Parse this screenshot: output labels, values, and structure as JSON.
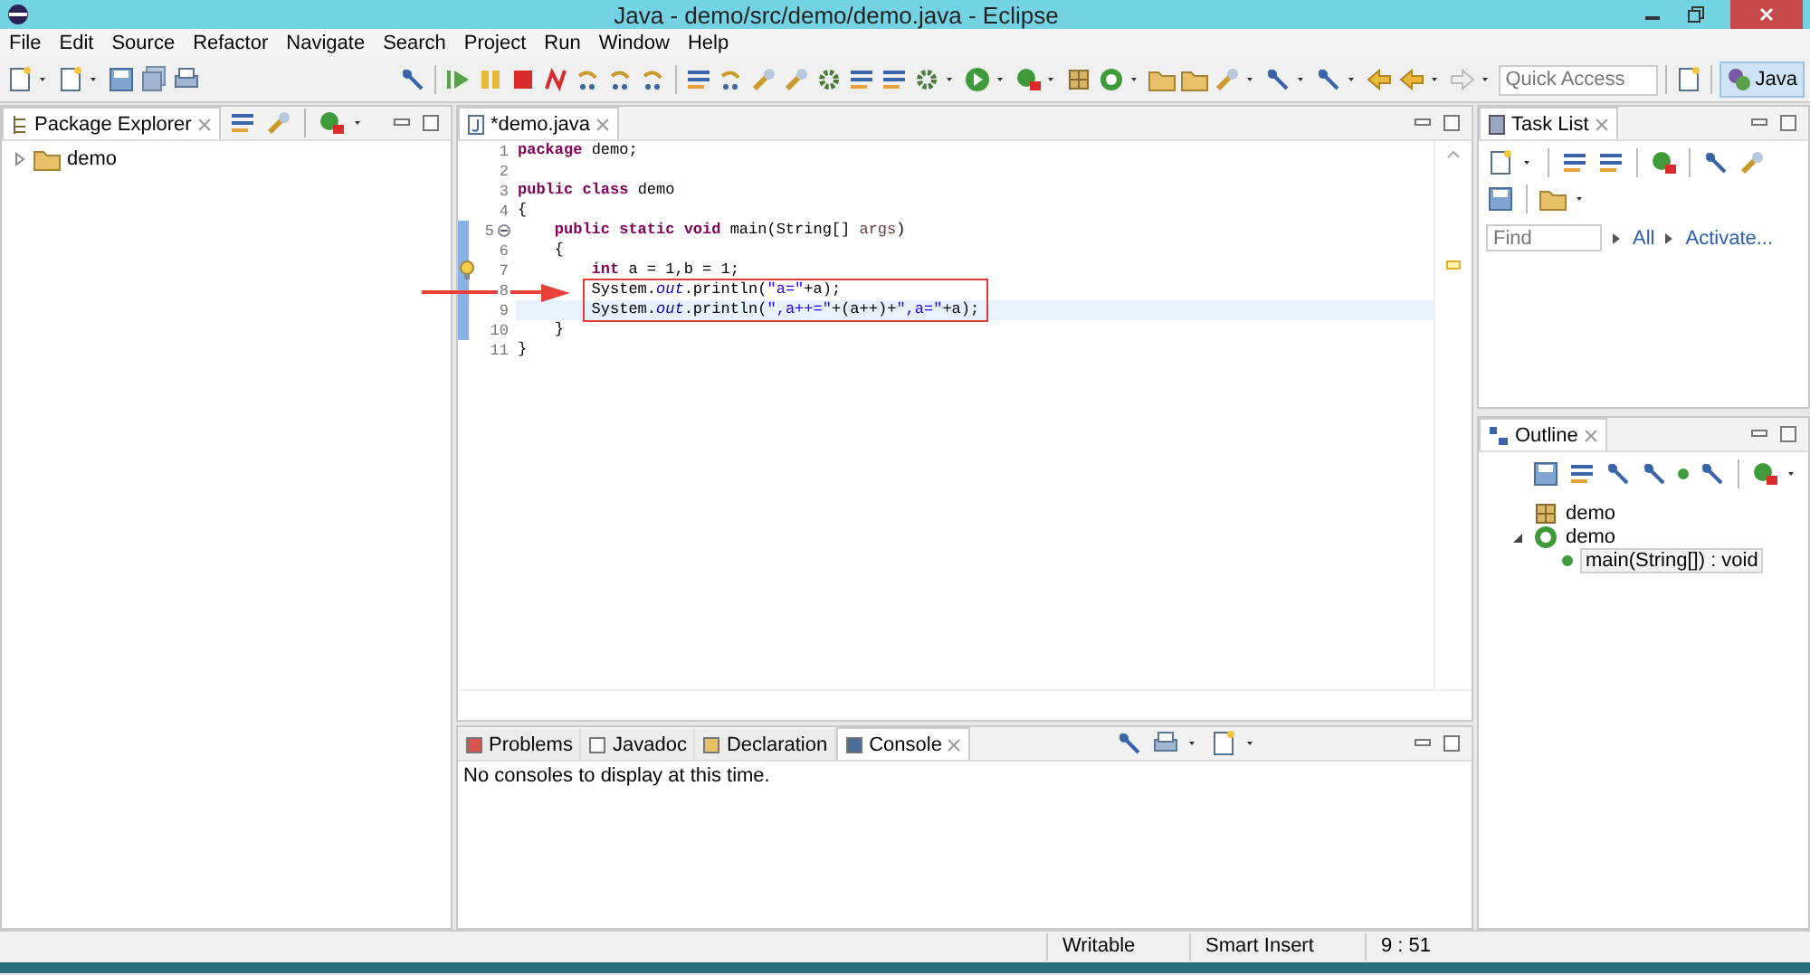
{
  "window": {
    "title": "Java - demo/src/demo/demo.java - Eclipse"
  },
  "menu": [
    "File",
    "Edit",
    "Source",
    "Refactor",
    "Navigate",
    "Search",
    "Project",
    "Run",
    "Window",
    "Help"
  ],
  "quick_access": {
    "placeholder": "Quick Access"
  },
  "perspectives": [
    {
      "label": "Java",
      "selected": true
    }
  ],
  "package_explorer": {
    "tabs": [
      {
        "label": "Package Explorer",
        "selected": true
      }
    ],
    "tree": [
      {
        "label": "demo",
        "expanded": false
      }
    ]
  },
  "editor": {
    "tabs": [
      {
        "label": "*demo.java",
        "selected": true
      }
    ],
    "lines": [
      {
        "number": "1",
        "current": false,
        "changed": false,
        "fold": false,
        "warning": false,
        "tokens": [
          {
            "kind": "keyword",
            "text": "package"
          },
          {
            "kind": "plain",
            "text": " demo;"
          }
        ]
      },
      {
        "number": "2",
        "current": false,
        "changed": false,
        "fold": false,
        "warning": false
      },
      {
        "number": "3",
        "current": false,
        "changed": false,
        "fold": false,
        "warning": false,
        "tokens": [
          {
            "kind": "keyword",
            "text": "public class"
          },
          {
            "kind": "plain",
            "text": " demo"
          }
        ]
      },
      {
        "number": "4",
        "current": false,
        "changed": false,
        "fold": false,
        "warning": false,
        "tokens": [
          {
            "kind": "plain",
            "text": "{"
          }
        ]
      },
      {
        "number": "5",
        "current": false,
        "changed": true,
        "fold": true,
        "warning": false,
        "tokens": [
          {
            "kind": "keyword",
            "text": "    public static void"
          },
          {
            "kind": "plain",
            "text": " main(String[] "
          },
          {
            "kind": "param",
            "text": "args"
          },
          {
            "kind": "plain",
            "text": ")"
          }
        ]
      },
      {
        "number": "6",
        "current": false,
        "changed": true,
        "fold": false,
        "warning": false,
        "tokens": [
          {
            "kind": "plain",
            "text": "    {"
          }
        ]
      },
      {
        "number": "7",
        "current": false,
        "changed": true,
        "fold": false,
        "warning": true,
        "tokens": [
          {
            "kind": "keyword",
            "text": "        int"
          },
          {
            "kind": "plain",
            "text": " a = 1,b = 1;"
          }
        ]
      },
      {
        "number": "8",
        "current": false,
        "changed": true,
        "fold": false,
        "warning": false,
        "tokens": [
          {
            "kind": "plain",
            "text": "        System."
          },
          {
            "kind": "field",
            "text": "out"
          },
          {
            "kind": "plain",
            "text": ".println("
          },
          {
            "kind": "string",
            "text": "\"a=\""
          },
          {
            "kind": "plain",
            "text": "+a);"
          }
        ]
      },
      {
        "number": "9",
        "current": true,
        "changed": true,
        "fold": false,
        "warning": false,
        "tokens": [
          {
            "kind": "plain",
            "text": "        System."
          },
          {
            "kind": "field",
            "text": "out"
          },
          {
            "kind": "plain",
            "text": ".println("
          },
          {
            "kind": "string",
            "text": "\",a++=\""
          },
          {
            "kind": "plain",
            "text": "+(a++)+"
          },
          {
            "kind": "string",
            "text": "\",a=\""
          },
          {
            "kind": "plain",
            "text": "+a);"
          }
        ]
      },
      {
        "number": "10",
        "current": false,
        "changed": true,
        "fold": false,
        "warning": false,
        "tokens": [
          {
            "kind": "plain",
            "text": "    }"
          }
        ]
      },
      {
        "number": "11",
        "current": false,
        "changed": false,
        "fold": false,
        "warning": false,
        "tokens": [
          {
            "kind": "plain",
            "text": "}"
          }
        ]
      }
    ]
  },
  "console": {
    "tabs": [
      {
        "label": "Problems",
        "selected": false
      },
      {
        "label": "Javadoc",
        "selected": false
      },
      {
        "label": "Declaration",
        "selected": false
      },
      {
        "label": "Console",
        "selected": true
      }
    ],
    "message": "No consoles to display at this time."
  },
  "task_list": {
    "tabs": [
      {
        "label": "Task List",
        "selected": true
      }
    ],
    "find": {
      "placeholder": "Find"
    },
    "links": [
      "All",
      "Activate..."
    ]
  },
  "outline": {
    "tabs": [
      {
        "label": "Outline",
        "selected": true
      }
    ],
    "tree": [
      {
        "label": "demo",
        "kind": "package",
        "selected": false
      },
      {
        "label": "demo",
        "kind": "class",
        "selected": false,
        "expanded": true,
        "children": [
          {
            "label": "main(String[]) : void",
            "kind": "method",
            "selected": true
          }
        ]
      }
    ]
  },
  "status_bar": [
    "Writable",
    "Smart Insert",
    "9 : 51"
  ]
}
